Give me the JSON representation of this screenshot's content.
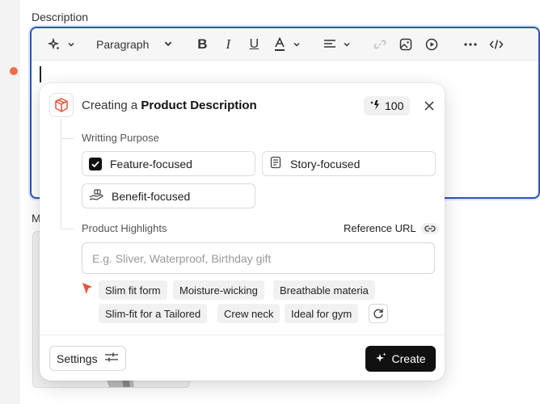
{
  "field": {
    "label": "Description"
  },
  "toolbar": {
    "paragraph_label": "Paragraph"
  },
  "below_label": "M",
  "popup": {
    "title_prefix": "Creating a ",
    "title_strong": "Product Description",
    "credits": "100",
    "purpose_label": "Writting Purpose",
    "purpose_options": [
      {
        "label": "Feature-focused",
        "checked": true
      },
      {
        "label": "Story-focused"
      },
      {
        "label": "Benefit-focused"
      }
    ],
    "highlights_label": "Product Highlights",
    "reference_url": "Reference URL",
    "highlights_placeholder": "E.g. Sliver, Waterproof, Birthday gift",
    "suggestions": [
      "Slim fit form",
      "Moisture-wicking",
      "Breathable materia",
      "Slim-fit for a Tailored",
      "Crew neck",
      "Ideal for gym"
    ],
    "settings_label": "Settings",
    "create_label": "Create"
  },
  "colors": {
    "focus_border": "#2d56b3",
    "error_dot": "#ef6e4b",
    "primary_button": "#111111",
    "spark": "#e5533a"
  }
}
